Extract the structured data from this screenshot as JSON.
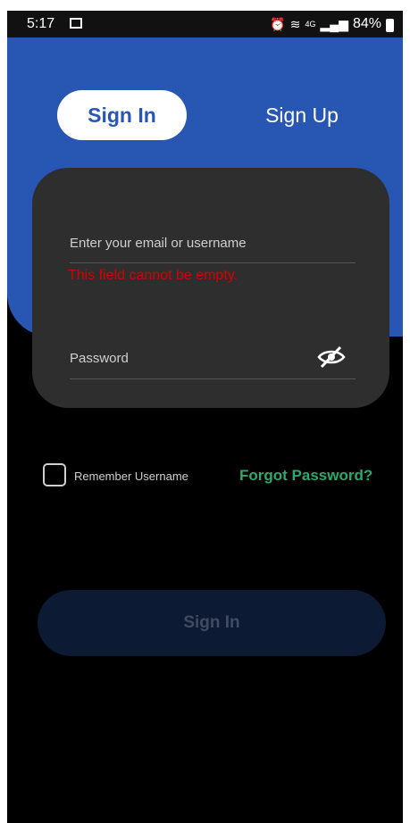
{
  "status_bar": {
    "time": "5:17",
    "network": "4G",
    "battery": "84%"
  },
  "tabs": {
    "signin": "Sign In",
    "signup": "Sign Up"
  },
  "form": {
    "email_placeholder": "Enter your email or username",
    "error": "This field cannot be empty.",
    "password_placeholder": "Password"
  },
  "options": {
    "remember_label": "Remember Username",
    "forgot_label": "Forgot Password?"
  },
  "actions": {
    "signin_button": "Sign In"
  },
  "icons": [
    "image-icon",
    "alarm-icon",
    "wifi-icon",
    "signal-icon",
    "battery-icon",
    "eye-off-icon"
  ],
  "colors": {
    "primary": "#2856b3",
    "error": "#d80000",
    "link": "#2fa86b",
    "card": "#2e2e2e",
    "button_disabled": "#0c1a33"
  }
}
